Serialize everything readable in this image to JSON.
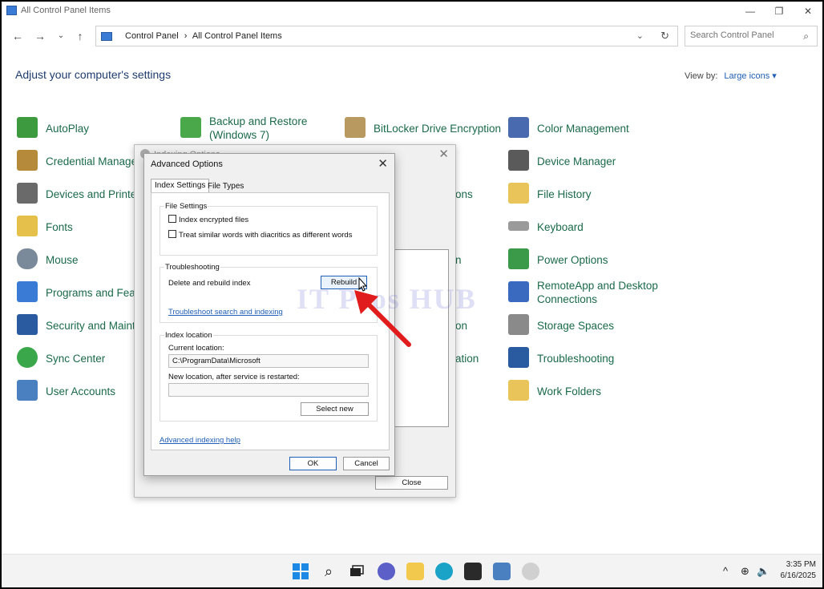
{
  "window": {
    "title": "All Control Panel Items"
  },
  "address": {
    "crumbs": [
      "Control Panel",
      "All Control Panel Items"
    ]
  },
  "search": {
    "placeholder": "Search Control Panel"
  },
  "heading": "Adjust your computer's settings",
  "view_by": {
    "label": "View by:",
    "value": "Large icons"
  },
  "items": {
    "autoplay": "AutoPlay",
    "backup": "Backup and Restore\n(Windows 7)",
    "bitlocker": "BitLocker Drive Encryption",
    "color": "Color Management",
    "credential": "Credential Manager",
    "device_manager": "Device Manager",
    "devices_printers": "Devices and Printers",
    "file_history": "File History",
    "fonts": "Fonts",
    "keyboard": "Keyboard",
    "mouse": "Mouse",
    "power": "Power Options",
    "programs": "Programs and Features",
    "remoteapp": "RemoteApp and Desktop\nConnections",
    "security": "Security and Maintenance",
    "storage": "Storage Spaces",
    "sync": "Sync Center",
    "troubleshooting": "Troubleshooting",
    "user_accounts": "User Accounts",
    "work_folders": "Work Folders",
    "partial_ons": "ons",
    "partial_n": "n",
    "partial_on": "on",
    "partial_ation": "ation"
  },
  "indexing_dialog": {
    "title": "Indexing Options",
    "close_label": "Close"
  },
  "advanced": {
    "title": "Advanced Options",
    "tabs": [
      "Index Settings",
      "File Types"
    ],
    "file_settings": {
      "label": "File Settings",
      "encrypt": "Index encrypted files",
      "diacritics": "Treat similar words with diacritics as different words"
    },
    "troubleshooting": {
      "label": "Troubleshooting",
      "delete_rebuild": "Delete and rebuild index",
      "rebuild_btn": "Rebuild",
      "link": "Troubleshoot search and indexing"
    },
    "index_location": {
      "label": "Index location",
      "current_label": "Current location:",
      "current_value": "C:\\ProgramData\\Microsoft",
      "new_label": "New location, after service is restarted:",
      "select_new": "Select new"
    },
    "help_link": "Advanced indexing help",
    "ok": "OK",
    "cancel": "Cancel"
  },
  "watermark": "IT Pros HUB",
  "clock": {
    "time": "3:35 PM",
    "date": "6/16/2025"
  },
  "colors": {
    "accent": "#1f5fb5",
    "item_text": "#1a6a4a",
    "heading": "#1e3c6e",
    "arrow": "#e11c1c"
  }
}
